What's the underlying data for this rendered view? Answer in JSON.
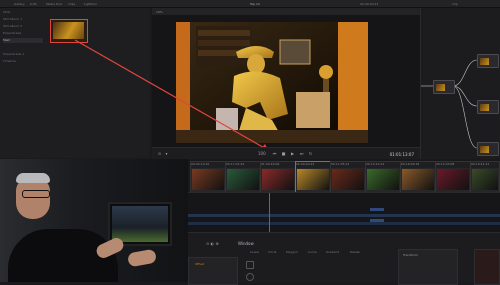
{
  "window": {
    "top_menu": [
      "Gallery",
      "LUTs",
      "Media Pool",
      "Clips",
      "Lightbox"
    ],
    "viewer_title": "Top 12",
    "zoom": "16%",
    "timecode_top": "00:00:00:23",
    "clip_label": "Clip"
  },
  "gallery": {
    "items": [
      "Stills",
      "Still Album 1",
      "Still Album 2",
      "PowerGrade",
      "Mem"
    ],
    "selected_index": 4,
    "footer_items": [
      "PowerGrade 1",
      "Timeline"
    ]
  },
  "transport": {
    "zoom": "100",
    "timecode": "01:01:13:07"
  },
  "clips": [
    {
      "num": "01",
      "tc": "00:04:10:10",
      "color": "#7a3a22"
    },
    {
      "num": "02",
      "tc": "00:17:01:22",
      "color": "#2a5a3a"
    },
    {
      "num": "03",
      "tc": "01:00:40:09",
      "color": "#8a2a2a"
    },
    {
      "num": "04",
      "tc": "00:00:00:23",
      "color": "#b8892a"
    },
    {
      "num": "05",
      "tc": "00:11:05:13",
      "color": "#6a2a1a"
    },
    {
      "num": "06",
      "tc": "00:14:10:12",
      "color": "#3a6a2a"
    },
    {
      "num": "07",
      "tc": "00:18:09:18",
      "color": "#8a5a2a"
    },
    {
      "num": "08",
      "tc": "00:12:03:08",
      "color": "#6a1a2a"
    },
    {
      "num": "09",
      "tc": "00:19:41:12",
      "color": "#3a4a2a"
    }
  ],
  "lower": {
    "title": "Window",
    "tabs": [
      "Linear",
      "Circle",
      "Polygon",
      "Curve",
      "Gradient",
      "Delete"
    ],
    "left_label": "Offset",
    "right_label": "Transform"
  },
  "colors": {
    "accent_red": "#e0463f",
    "track_blue": "#2f4a7a"
  }
}
